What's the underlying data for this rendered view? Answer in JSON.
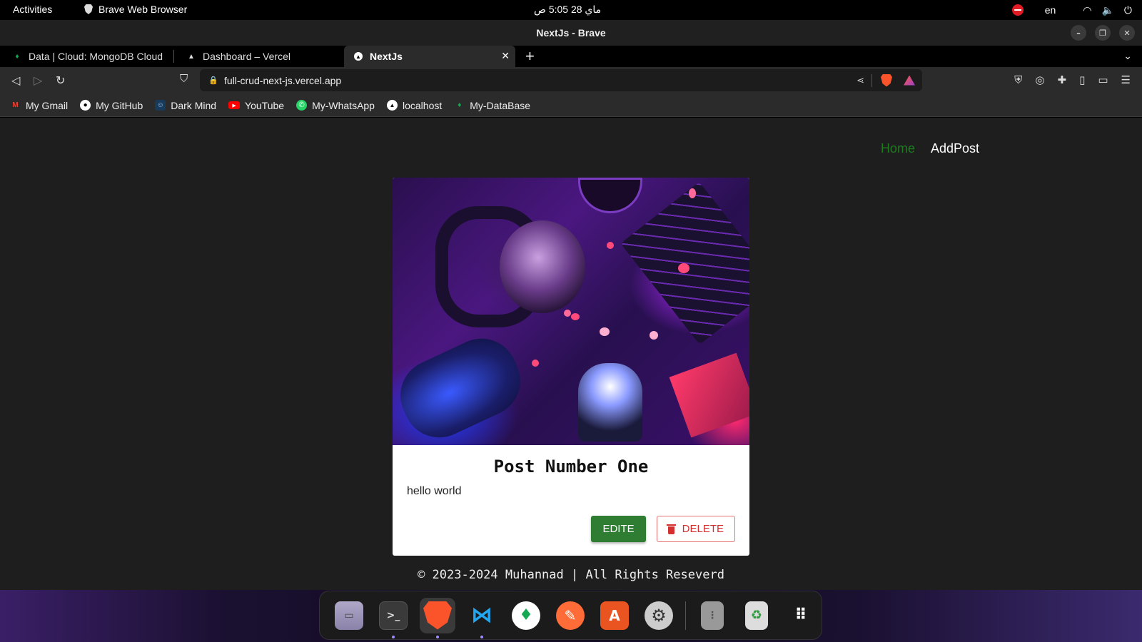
{
  "topbar": {
    "activities": "Activities",
    "app_name": "Brave Web Browser",
    "clock": "ماي 28  5:05 ص",
    "lang": "en"
  },
  "window": {
    "title": "NextJs - Brave"
  },
  "tabs": [
    {
      "label": "Data | Cloud: MongoDB Cloud",
      "icon": "mongodb-leaf-icon"
    },
    {
      "label": "Dashboard – Vercel",
      "icon": "vercel-triangle-icon"
    },
    {
      "label": "NextJs",
      "icon": "vercel-triangle-icon",
      "active": true
    }
  ],
  "toolbar": {
    "url": "full-crud-next-js.vercel.app"
  },
  "bookmarks": [
    {
      "label": "My Gmail",
      "icon": "gmail-icon",
      "color": "#ea4335"
    },
    {
      "label": "My GitHub",
      "icon": "github-icon",
      "color": "#ffffff"
    },
    {
      "label": "Dark Mind",
      "icon": "darkmind-icon",
      "color": "#1a3a5a"
    },
    {
      "label": "YouTube",
      "icon": "youtube-icon",
      "color": "#ff0000"
    },
    {
      "label": "My-WhatsApp",
      "icon": "whatsapp-icon",
      "color": "#25d366"
    },
    {
      "label": "localhost",
      "icon": "vercel-triangle-icon",
      "color": "#ffffff"
    },
    {
      "label": "My-DataBase",
      "icon": "mongodb-leaf-icon",
      "color": "#13aa52"
    }
  ],
  "page": {
    "nav": {
      "home": "Home",
      "addpost": "AddPost"
    },
    "post": {
      "title": "Post Number One",
      "body": "hello world",
      "edit_label": "EDITE",
      "delete_label": "DELETE"
    },
    "footer": "© 2023-2024 Muhannad | All Rights Reseverd"
  },
  "colors": {
    "nav_home": "#1e7b1e",
    "edit_button": "#2e7d32",
    "delete_button": "#d32f2f",
    "page_bg": "#1e1e1e"
  },
  "dock": [
    {
      "name": "files",
      "icon": "files-icon"
    },
    {
      "name": "terminal",
      "icon": "terminal-icon",
      "running": true
    },
    {
      "name": "brave",
      "icon": "brave-icon",
      "running": true,
      "focused": true
    },
    {
      "name": "vscode",
      "icon": "vscode-icon",
      "running": true
    },
    {
      "name": "mongodb-compass",
      "icon": "mongodb-leaf-icon"
    },
    {
      "name": "postman",
      "icon": "postman-icon"
    },
    {
      "name": "app-center",
      "icon": "app-center-icon"
    },
    {
      "name": "settings",
      "icon": "settings-icon"
    },
    {
      "name": "disks",
      "icon": "disks-icon"
    },
    {
      "name": "trash",
      "icon": "trash-icon"
    },
    {
      "name": "show-apps",
      "icon": "app-grid-icon"
    }
  ]
}
